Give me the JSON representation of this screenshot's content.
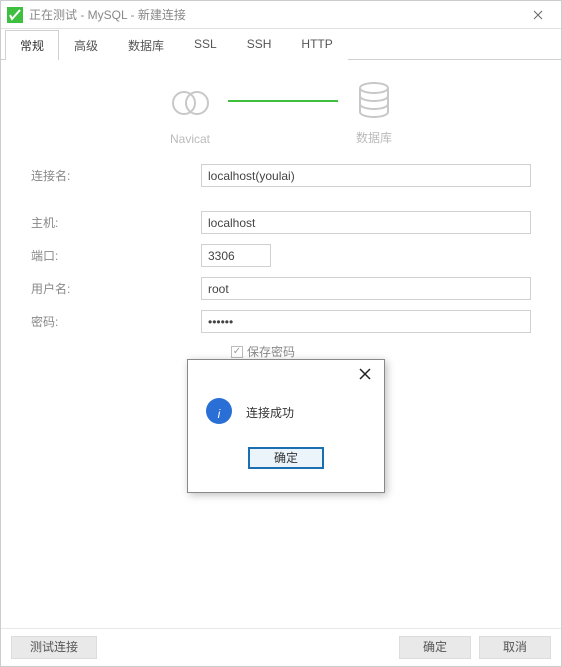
{
  "window": {
    "title": "正在测试 - MySQL - 新建连接"
  },
  "tabs": {
    "general": "常规",
    "advanced": "高级",
    "database": "数据库",
    "ssl": "SSL",
    "ssh": "SSH",
    "http": "HTTP"
  },
  "graphic": {
    "left": "Navicat",
    "right": "数据库"
  },
  "form": {
    "conn_name_label": "连接名:",
    "conn_name_value": "localhost(youlai)",
    "host_label": "主机:",
    "host_value": "localhost",
    "port_label": "端口:",
    "port_value": "3306",
    "user_label": "用户名:",
    "user_value": "root",
    "pass_label": "密码:",
    "pass_value": "••••••",
    "save_pass_label": "保存密码"
  },
  "footer": {
    "test": "测试连接",
    "ok": "确定",
    "cancel": "取消"
  },
  "modal": {
    "message": "连接成功",
    "ok": "确定"
  }
}
